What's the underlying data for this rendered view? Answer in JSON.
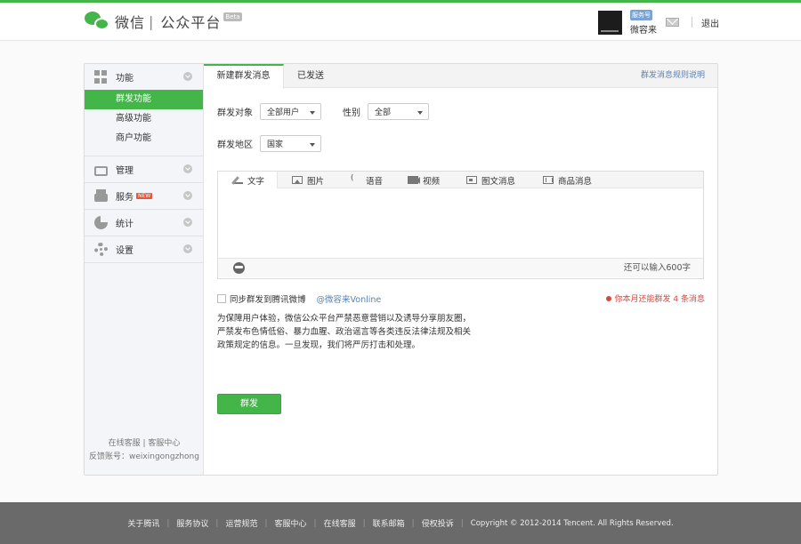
{
  "header": {
    "logo_text": "微信",
    "logo_divider": "|",
    "logo_subtitle": "公众平台",
    "logo_badge": "Beta",
    "account_type": "服务号",
    "account_name": "微容来",
    "logout": "退出",
    "icons": [
      "wechat-logo-icon",
      "mail-icon"
    ]
  },
  "sidebar": {
    "groups": [
      {
        "label": "功能",
        "icon": "grid-icon",
        "items": [
          {
            "label": "群发功能",
            "active": true
          },
          {
            "label": "高级功能"
          },
          {
            "label": "商户功能"
          }
        ]
      },
      {
        "label": "管理",
        "icon": "tray-icon"
      },
      {
        "label": "服务",
        "icon": "printer-icon",
        "badge": "NEW"
      },
      {
        "label": "统计",
        "icon": "pie-icon"
      },
      {
        "label": "设置",
        "icon": "gear-icon"
      }
    ],
    "footer_links": [
      "在线客服",
      "客服中心"
    ],
    "footer_sep": "|",
    "feedback": "反馈账号：weixingongzhong"
  },
  "main": {
    "tabs": [
      "新建群发消息",
      "已发送"
    ],
    "tab_link": "群发消息规则说明",
    "form": {
      "target_label": "群发对象",
      "target_value": "全部用户",
      "gender_label": "性别",
      "gender_value": "全部",
      "region_label": "群发地区",
      "region_value": "国家"
    },
    "editor": {
      "tabs": [
        {
          "label": "文字",
          "icon": "pen-icon"
        },
        {
          "label": "图片",
          "icon": "image-icon"
        },
        {
          "label": "语音",
          "icon": "voice-icon"
        },
        {
          "label": "视频",
          "icon": "video-icon"
        },
        {
          "label": "图文消息",
          "icon": "news-icon"
        },
        {
          "label": "商品消息",
          "icon": "goods-icon"
        }
      ],
      "counter": "还可以输入600字"
    },
    "sync_label": "同步群发到腾讯微博",
    "sync_handle": "@微容来Vonline",
    "remaining": "你本月还能群发 4 条消息",
    "notice": [
      "为保障用户体验，微信公众平台严禁恶意营销以及诱导分享朋友圈，",
      "严禁发布色情低俗、暴力血腥、政治谣言等各类违反法律法规及相关",
      "政策规定的信息。一旦发现，我们将严厉打击和处理。"
    ],
    "send_button": "群发"
  },
  "footer": {
    "links": [
      "关于腾讯",
      "服务协议",
      "运营规范",
      "客服中心",
      "在线客服",
      "联系邮箱",
      "侵权投诉"
    ],
    "copyright": "Copyright © 2012-2014 Tencent. All Rights Reserved."
  },
  "colors": {
    "accent": "#44b549",
    "link": "#5a82b5",
    "warning": "#d9473b",
    "footer_bg": "#6a6a6a"
  }
}
